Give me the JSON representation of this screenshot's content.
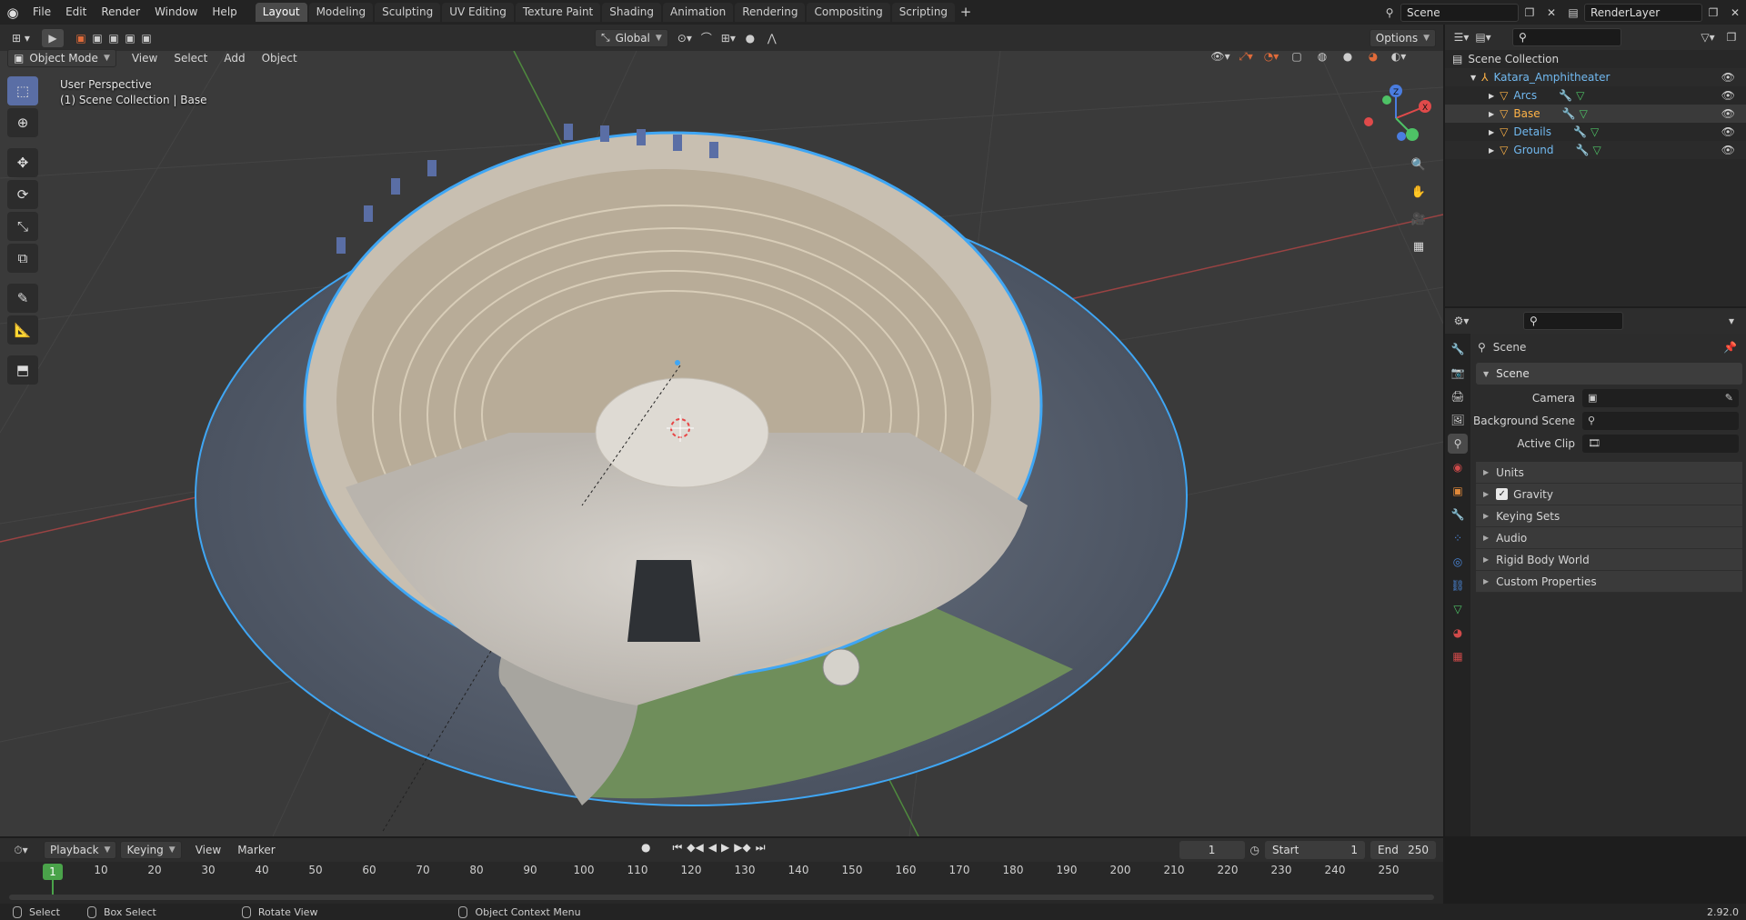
{
  "topbar": {
    "menu": [
      "File",
      "Edit",
      "Render",
      "Window",
      "Help"
    ],
    "workspaces": [
      {
        "label": "Layout",
        "active": true
      },
      {
        "label": "Modeling",
        "active": false
      },
      {
        "label": "Sculpting",
        "active": false
      },
      {
        "label": "UV Editing",
        "active": false
      },
      {
        "label": "Texture Paint",
        "active": false
      },
      {
        "label": "Shading",
        "active": false
      },
      {
        "label": "Animation",
        "active": false
      },
      {
        "label": "Rendering",
        "active": false
      },
      {
        "label": "Compositing",
        "active": false
      },
      {
        "label": "Scripting",
        "active": false
      }
    ],
    "add_workspace": "+",
    "scene_name": "Scene",
    "view_layer": "RenderLayer"
  },
  "viewport_header": {
    "mode": "Object Mode",
    "menus": [
      "View",
      "Select",
      "Add",
      "Object"
    ],
    "orientation": "Global",
    "options": "Options"
  },
  "viewport": {
    "perspective": "User Perspective",
    "collection_info": "(1) Scene Collection | Base"
  },
  "outliner": {
    "root": "Scene Collection",
    "collection": "Katara_Amphitheater",
    "objects": [
      {
        "name": "Arcs",
        "active": false
      },
      {
        "name": "Base",
        "active": true
      },
      {
        "name": "Details",
        "active": false
      },
      {
        "name": "Ground",
        "active": false
      }
    ]
  },
  "properties": {
    "context": "Scene",
    "panel_title": "Scene",
    "fields": [
      {
        "label": "Camera"
      },
      {
        "label": "Background Scene"
      },
      {
        "label": "Active Clip"
      }
    ],
    "subpanels": [
      "Units",
      "Gravity",
      "Keying Sets",
      "Audio",
      "Rigid Body World",
      "Custom Properties"
    ],
    "gravity_checked": "✓"
  },
  "timeline": {
    "menus": [
      "Playback",
      "Keying",
      "View",
      "Marker"
    ],
    "current_frame": "1",
    "start_label": "Start",
    "start": "1",
    "end_label": "End",
    "end": "250",
    "frame_labels": [
      "10",
      "20",
      "30",
      "40",
      "50",
      "60",
      "70",
      "80",
      "90",
      "100",
      "110",
      "120",
      "130",
      "140",
      "150",
      "160",
      "170",
      "180",
      "190",
      "200",
      "210",
      "220",
      "230",
      "240",
      "250"
    ]
  },
  "statusbar": {
    "items": [
      "Select",
      "Box Select",
      "Rotate View",
      "Object Context Menu"
    ],
    "version": "2.92.0"
  },
  "colors": {
    "accent_blue": "#71b9f0",
    "active_orange": "#ffb347",
    "frame_green": "#4aa34a",
    "selection_outline": "#3fa6f4"
  }
}
